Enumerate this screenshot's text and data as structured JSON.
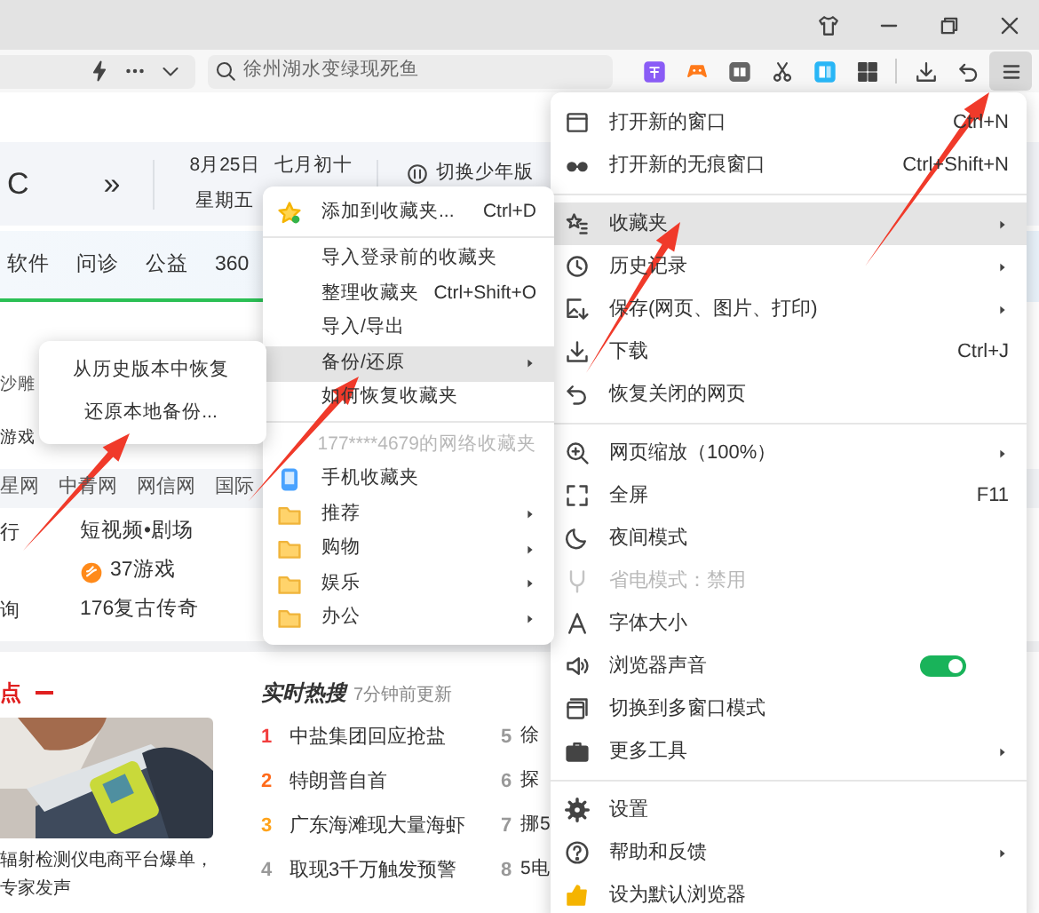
{
  "toolbar": {
    "search": {
      "placeholder": "徐州湖水变绿现死鱼"
    }
  },
  "calendar": {
    "temperature": "C",
    "more": "»",
    "date": "8月25日",
    "lunar_date": "七月初十",
    "weekday": "星期五",
    "youth_mode": "切换少年版"
  },
  "nav_tabs": [
    "软件",
    "问诊",
    "公益",
    "360"
  ],
  "hot_tags": [
    "沙雕",
    "游戏"
  ],
  "site_links": [
    "星网",
    "中青网",
    "网信网",
    "国际"
  ],
  "quick_links": [
    {
      "column_1": "行",
      "column_2": "短视频•剧场"
    },
    {
      "column_2": "37游戏"
    },
    {
      "column_1": "询",
      "column_2": "176复古传奇"
    }
  ],
  "news": {
    "heading": "点",
    "caption": [
      "辐射检测仪电商平台爆单，",
      "专家发声"
    ]
  },
  "hot_search": {
    "title": "实时热搜",
    "updated": "7分钟前更新",
    "items": [
      {
        "rank": "1",
        "text": "中盐集团回应抢盐",
        "color": "#f23d3d"
      },
      {
        "rank": "2",
        "text": "特朗普自首",
        "color": "#ff6a1a"
      },
      {
        "rank": "3",
        "text": "广东海滩现大量海虾",
        "color": "#ffa31a"
      },
      {
        "rank": "4",
        "text": "取现3千万触发预警",
        "color": "#999999"
      },
      {
        "rank": "5",
        "text": "徐",
        "color": "#999999"
      },
      {
        "rank": "6",
        "text": "探",
        "color": "#999999"
      },
      {
        "rank": "7",
        "text": "挪5",
        "color": "#999999"
      },
      {
        "rank": "8",
        "text": "5电",
        "color": "#999999"
      }
    ]
  },
  "main_menu": {
    "groups": [
      [
        {
          "label": "打开新的窗口",
          "shortcut": "Ctrl+N",
          "has_submenu": false,
          "selected": false,
          "disabled": false
        },
        {
          "label": "打开新的无痕窗口",
          "shortcut": "Ctrl+Shift+N",
          "has_submenu": false,
          "selected": false,
          "disabled": false
        }
      ],
      [
        {
          "label": "收藏夹",
          "has_submenu": true,
          "selected": true,
          "disabled": false
        },
        {
          "label": "历史记录",
          "has_submenu": true,
          "selected": false,
          "disabled": false
        },
        {
          "label": "保存(网页、图片、打印)",
          "has_submenu": true,
          "selected": false,
          "disabled": false
        },
        {
          "label": "下载",
          "shortcut": "Ctrl+J",
          "has_submenu": false,
          "selected": false,
          "disabled": false
        },
        {
          "label": "恢复关闭的网页",
          "has_submenu": false,
          "selected": false,
          "disabled": false
        }
      ],
      [
        {
          "label": "网页缩放（100%）",
          "has_submenu": true,
          "selected": false,
          "disabled": false
        },
        {
          "label": "全屏",
          "shortcut": "F11",
          "has_submenu": false,
          "selected": false,
          "disabled": false
        },
        {
          "label": "夜间模式",
          "has_submenu": false,
          "selected": false,
          "disabled": false
        },
        {
          "label": "省电模式：禁用",
          "has_submenu": false,
          "selected": false,
          "disabled": true
        },
        {
          "label": "字体大小",
          "has_submenu": false,
          "selected": false,
          "disabled": false
        },
        {
          "label": "浏览器声音",
          "has_submenu": false,
          "selected": false,
          "disabled": false,
          "kind": "toggle",
          "on": true
        },
        {
          "label": "切换到多窗口模式",
          "has_submenu": false,
          "selected": false,
          "disabled": false
        },
        {
          "label": "更多工具",
          "has_submenu": true,
          "selected": false,
          "disabled": false
        }
      ],
      [
        {
          "label": "设置",
          "has_submenu": false,
          "selected": false,
          "disabled": false
        },
        {
          "label": "帮助和反馈",
          "has_submenu": true,
          "selected": false,
          "disabled": false
        },
        {
          "label": "设为默认浏览器",
          "has_submenu": false,
          "selected": false,
          "disabled": false
        }
      ]
    ]
  },
  "bookmarks_menu": {
    "groups": [
      [
        {
          "label": "添加到收藏夹...",
          "shortcut": "Ctrl+D",
          "has_submenu": false,
          "selected": false,
          "disabled": false
        }
      ],
      [
        {
          "label": "导入登录前的收藏夹",
          "has_submenu": false,
          "selected": false,
          "disabled": false
        },
        {
          "label": "整理收藏夹",
          "shortcut": "Ctrl+Shift+O",
          "has_submenu": false,
          "selected": false,
          "disabled": false
        },
        {
          "label": "导入/导出",
          "has_submenu": false,
          "selected": false,
          "disabled": false
        },
        {
          "label": "备份/还原",
          "has_submenu": true,
          "selected": true,
          "disabled": false
        },
        {
          "label": "如何恢复收藏夹",
          "has_submenu": false,
          "selected": false,
          "disabled": false
        }
      ],
      [
        {
          "label": "177****4679的网络收藏夹",
          "has_submenu": false,
          "selected": false,
          "disabled": true
        },
        {
          "label": "手机收藏夹",
          "has_submenu": false,
          "selected": false,
          "disabled": false
        },
        {
          "label": "推荐",
          "has_submenu": true,
          "selected": false,
          "disabled": false
        },
        {
          "label": "购物",
          "has_submenu": true,
          "selected": false,
          "disabled": false
        },
        {
          "label": "娱乐",
          "has_submenu": true,
          "selected": false,
          "disabled": false
        },
        {
          "label": "办公",
          "has_submenu": true,
          "selected": false,
          "disabled": false
        }
      ]
    ]
  },
  "backup_menu": {
    "items": [
      {
        "label": "从历史版本中恢复",
        "selected": false
      },
      {
        "label": "还原本地备份...",
        "selected": false
      }
    ]
  }
}
